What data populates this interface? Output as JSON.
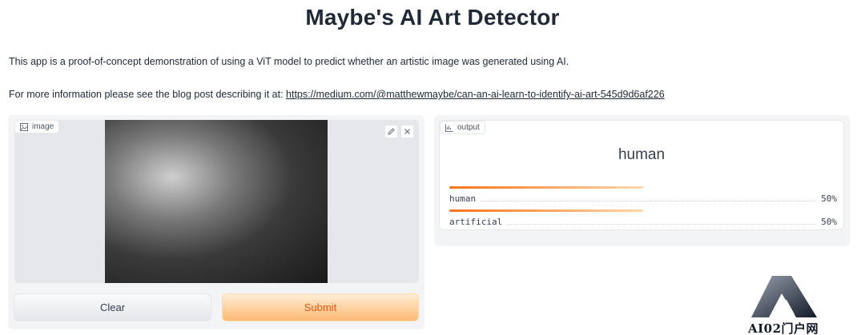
{
  "header": {
    "title": "Maybe's AI Art Detector"
  },
  "description": "This app is a proof-of-concept demonstration of using a ViT model to predict whether an artistic image was generated using AI.",
  "info": {
    "prefix": "For more information please see the blog post describing it at:",
    "link_text": "https://medium.com/@matthewmaybe/can-an-ai-learn-to-identify-ai-art-545d9d6af226"
  },
  "input": {
    "label": "image",
    "icon": "image-icon",
    "tools": [
      "edit-icon",
      "close-icon"
    ]
  },
  "buttons": {
    "clear": "Clear",
    "submit": "Submit"
  },
  "output": {
    "label": "output",
    "icon": "chart-icon",
    "top_label": "human",
    "confidences": [
      {
        "label": "human",
        "value": "50%",
        "fraction": 0.5
      },
      {
        "label": "artificial",
        "value": "50%",
        "fraction": 0.5
      }
    ]
  },
  "watermark": {
    "text": "AI02门户网"
  },
  "colors": {
    "accent": "#f97316",
    "submit_text": "#ea580c"
  }
}
